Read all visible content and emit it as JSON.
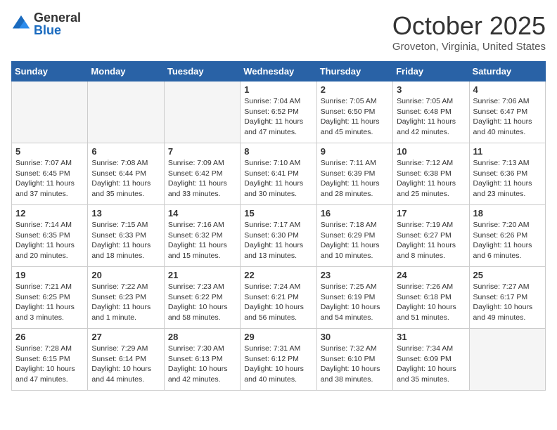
{
  "header": {
    "logo_general": "General",
    "logo_blue": "Blue",
    "title": "October 2025",
    "location": "Groveton, Virginia, United States"
  },
  "days_of_week": [
    "Sunday",
    "Monday",
    "Tuesday",
    "Wednesday",
    "Thursday",
    "Friday",
    "Saturday"
  ],
  "weeks": [
    [
      {
        "day": "",
        "info": ""
      },
      {
        "day": "",
        "info": ""
      },
      {
        "day": "",
        "info": ""
      },
      {
        "day": "1",
        "info": "Sunrise: 7:04 AM\nSunset: 6:52 PM\nDaylight: 11 hours and 47 minutes."
      },
      {
        "day": "2",
        "info": "Sunrise: 7:05 AM\nSunset: 6:50 PM\nDaylight: 11 hours and 45 minutes."
      },
      {
        "day": "3",
        "info": "Sunrise: 7:05 AM\nSunset: 6:48 PM\nDaylight: 11 hours and 42 minutes."
      },
      {
        "day": "4",
        "info": "Sunrise: 7:06 AM\nSunset: 6:47 PM\nDaylight: 11 hours and 40 minutes."
      }
    ],
    [
      {
        "day": "5",
        "info": "Sunrise: 7:07 AM\nSunset: 6:45 PM\nDaylight: 11 hours and 37 minutes."
      },
      {
        "day": "6",
        "info": "Sunrise: 7:08 AM\nSunset: 6:44 PM\nDaylight: 11 hours and 35 minutes."
      },
      {
        "day": "7",
        "info": "Sunrise: 7:09 AM\nSunset: 6:42 PM\nDaylight: 11 hours and 33 minutes."
      },
      {
        "day": "8",
        "info": "Sunrise: 7:10 AM\nSunset: 6:41 PM\nDaylight: 11 hours and 30 minutes."
      },
      {
        "day": "9",
        "info": "Sunrise: 7:11 AM\nSunset: 6:39 PM\nDaylight: 11 hours and 28 minutes."
      },
      {
        "day": "10",
        "info": "Sunrise: 7:12 AM\nSunset: 6:38 PM\nDaylight: 11 hours and 25 minutes."
      },
      {
        "day": "11",
        "info": "Sunrise: 7:13 AM\nSunset: 6:36 PM\nDaylight: 11 hours and 23 minutes."
      }
    ],
    [
      {
        "day": "12",
        "info": "Sunrise: 7:14 AM\nSunset: 6:35 PM\nDaylight: 11 hours and 20 minutes."
      },
      {
        "day": "13",
        "info": "Sunrise: 7:15 AM\nSunset: 6:33 PM\nDaylight: 11 hours and 18 minutes."
      },
      {
        "day": "14",
        "info": "Sunrise: 7:16 AM\nSunset: 6:32 PM\nDaylight: 11 hours and 15 minutes."
      },
      {
        "day": "15",
        "info": "Sunrise: 7:17 AM\nSunset: 6:30 PM\nDaylight: 11 hours and 13 minutes."
      },
      {
        "day": "16",
        "info": "Sunrise: 7:18 AM\nSunset: 6:29 PM\nDaylight: 11 hours and 10 minutes."
      },
      {
        "day": "17",
        "info": "Sunrise: 7:19 AM\nSunset: 6:27 PM\nDaylight: 11 hours and 8 minutes."
      },
      {
        "day": "18",
        "info": "Sunrise: 7:20 AM\nSunset: 6:26 PM\nDaylight: 11 hours and 6 minutes."
      }
    ],
    [
      {
        "day": "19",
        "info": "Sunrise: 7:21 AM\nSunset: 6:25 PM\nDaylight: 11 hours and 3 minutes."
      },
      {
        "day": "20",
        "info": "Sunrise: 7:22 AM\nSunset: 6:23 PM\nDaylight: 11 hours and 1 minute."
      },
      {
        "day": "21",
        "info": "Sunrise: 7:23 AM\nSunset: 6:22 PM\nDaylight: 10 hours and 58 minutes."
      },
      {
        "day": "22",
        "info": "Sunrise: 7:24 AM\nSunset: 6:21 PM\nDaylight: 10 hours and 56 minutes."
      },
      {
        "day": "23",
        "info": "Sunrise: 7:25 AM\nSunset: 6:19 PM\nDaylight: 10 hours and 54 minutes."
      },
      {
        "day": "24",
        "info": "Sunrise: 7:26 AM\nSunset: 6:18 PM\nDaylight: 10 hours and 51 minutes."
      },
      {
        "day": "25",
        "info": "Sunrise: 7:27 AM\nSunset: 6:17 PM\nDaylight: 10 hours and 49 minutes."
      }
    ],
    [
      {
        "day": "26",
        "info": "Sunrise: 7:28 AM\nSunset: 6:15 PM\nDaylight: 10 hours and 47 minutes."
      },
      {
        "day": "27",
        "info": "Sunrise: 7:29 AM\nSunset: 6:14 PM\nDaylight: 10 hours and 44 minutes."
      },
      {
        "day": "28",
        "info": "Sunrise: 7:30 AM\nSunset: 6:13 PM\nDaylight: 10 hours and 42 minutes."
      },
      {
        "day": "29",
        "info": "Sunrise: 7:31 AM\nSunset: 6:12 PM\nDaylight: 10 hours and 40 minutes."
      },
      {
        "day": "30",
        "info": "Sunrise: 7:32 AM\nSunset: 6:10 PM\nDaylight: 10 hours and 38 minutes."
      },
      {
        "day": "31",
        "info": "Sunrise: 7:34 AM\nSunset: 6:09 PM\nDaylight: 10 hours and 35 minutes."
      },
      {
        "day": "",
        "info": ""
      }
    ]
  ]
}
